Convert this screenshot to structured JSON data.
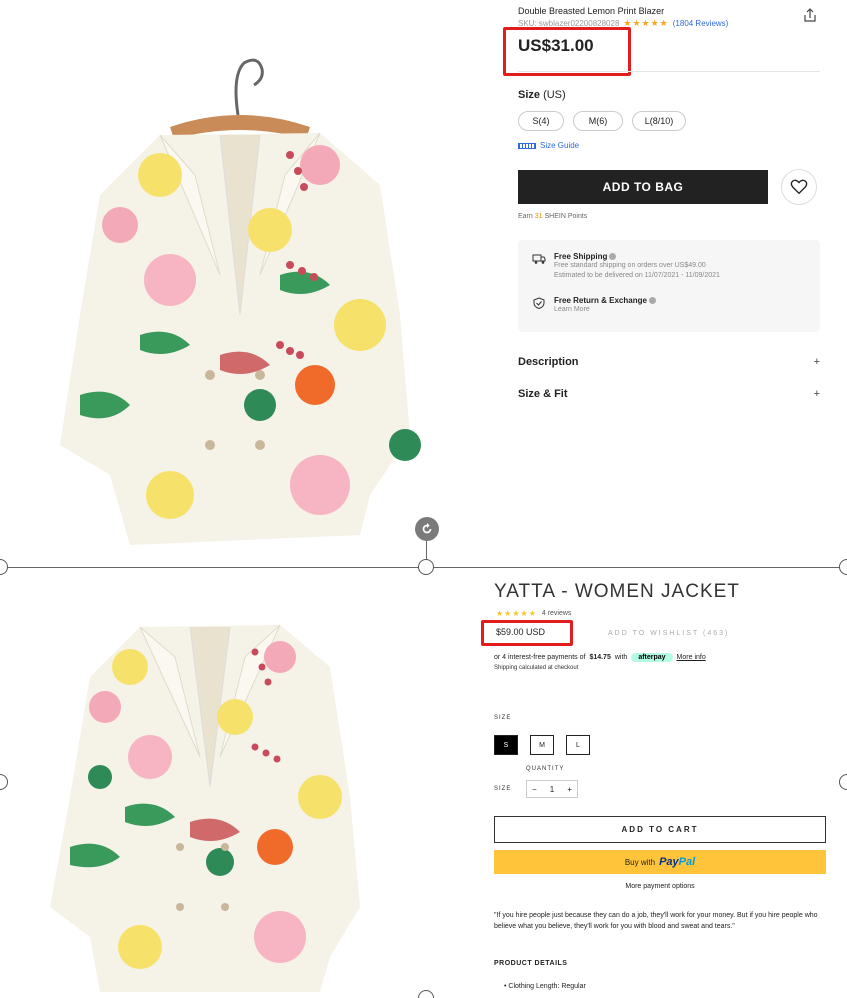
{
  "top": {
    "product_title": "Double Breasted Lemon Print Blazer",
    "sku": "SKU: swblazer02200828028",
    "stars": "★★★★★",
    "reviews": "(1804 Reviews)",
    "price": "US$31.00",
    "size_label": "Size",
    "size_unit": "(US)",
    "sizes": [
      "S(4)",
      "M(6)",
      "L(8/10)"
    ],
    "size_guide": "Size Guide",
    "add_to_bag": "ADD TO BAG",
    "points_prefix": "Earn",
    "points_value": "31",
    "points_suffix": "SHEIN Points",
    "shipping": {
      "title": "Free Shipping",
      "line1": "Free standard shipping on orders over US$49.00",
      "line2": "Estimated to be delivered on 11/07/2021 - 11/09/2021"
    },
    "returns": {
      "title": "Free Return & Exchange",
      "line1": "Learn More"
    },
    "accordions": [
      "Description",
      "Size & Fit"
    ],
    "plus": "+"
  },
  "bottom": {
    "title": "YATTA - WOMEN JACKET",
    "stars": "★★★★★",
    "reviews": "4 reviews",
    "price": "$59.00 USD",
    "wishlist": "ADD TO WISHLIST (463)",
    "installment_prefix": "or 4 interest-free payments of",
    "installment_amount": "$14.75",
    "installment_with": "with",
    "afterpay": "afterpay",
    "more_info": "More info",
    "shipping_calc": "Shipping calculated at checkout",
    "size_label": "SIZE",
    "sizes": [
      "S",
      "M",
      "L"
    ],
    "quantity_label": "QUANTITY",
    "size_label_2": "SIZE",
    "qty_minus": "−",
    "qty_value": "1",
    "qty_plus": "+",
    "add_to_cart": "ADD TO CART",
    "buy_with": "Buy with",
    "paypal_a": "Pay",
    "paypal_b": "Pal",
    "more_payment": "More payment options",
    "quote": "\"If you hire people just because they can do a job, they'll work for your money. But if you hire people who believe what you believe, they'll work for you with blood and sweat and tears.\"",
    "details_heading": "PRODUCT DETAILS",
    "detail_bullet": "• Clothing Length: Regular"
  },
  "colors": {
    "highlight": "#e11d1d",
    "star_top": "#f5a623",
    "star_bottom": "#f3c623",
    "link": "#2f6bd9",
    "button_dark": "#222222",
    "paypal_yellow": "#ffc439",
    "afterpay_mint": "#b2fce4"
  }
}
